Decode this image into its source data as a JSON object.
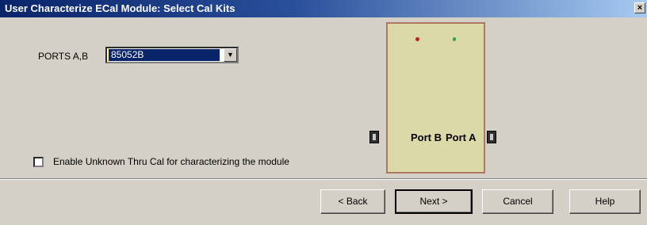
{
  "window": {
    "title": "User Characterize ECal Module: Select Cal Kits",
    "close_glyph": "×"
  },
  "ports": {
    "label": "PORTS A,B",
    "selected_value": "85052B",
    "dropdown_glyph": "▼"
  },
  "checkbox": {
    "label": "Enable Unknown Thru Cal for characterizing the module",
    "checked": false
  },
  "module": {
    "port_b_label": "Port B",
    "port_a_label": "Port A",
    "led_colors": [
      "#c02020",
      "#30a040"
    ],
    "body_color": "#dcd9a8"
  },
  "buttons": {
    "back": "< Back",
    "next": "Next >",
    "cancel": "Cancel",
    "help": "Help"
  }
}
